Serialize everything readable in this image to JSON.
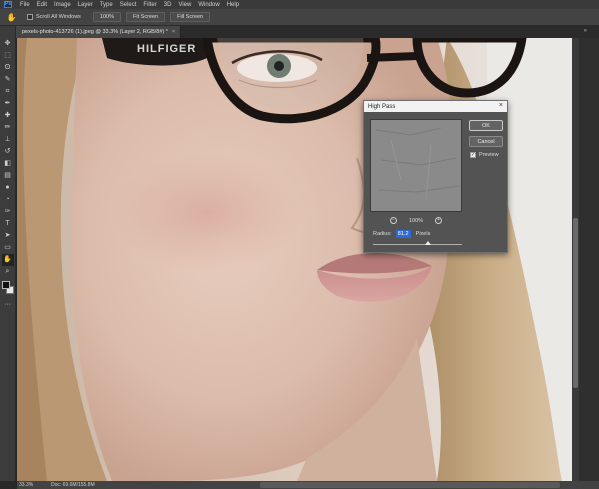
{
  "menubar": {
    "logo": "Ps",
    "items": [
      "File",
      "Edit",
      "Image",
      "Layer",
      "Type",
      "Select",
      "Filter",
      "3D",
      "View",
      "Window",
      "Help"
    ]
  },
  "options_bar": {
    "tool_icon": "hand-icon",
    "scroll_all_windows_label": "Scroll All Windows",
    "scroll_all_windows_checked": false,
    "zoom_btn": "100%",
    "fit_screen_btn": "Fit Screen",
    "fill_screen_btn": "Fill Screen"
  },
  "document_tab": {
    "title": "pexels-photo-413726 (1).jpeg @ 33.3% (Layer 2, RGB/8#) *",
    "close": "×"
  },
  "tools": [
    {
      "name": "move-tool",
      "icon": "✥"
    },
    {
      "name": "marquee-tool",
      "icon": "⬚"
    },
    {
      "name": "lasso-tool",
      "icon": "ʘ"
    },
    {
      "name": "quick-select-tool",
      "icon": "✎"
    },
    {
      "name": "crop-tool",
      "icon": "⌗"
    },
    {
      "name": "eyedropper-tool",
      "icon": "✒"
    },
    {
      "name": "healing-tool",
      "icon": "✚"
    },
    {
      "name": "brush-tool",
      "icon": "✏"
    },
    {
      "name": "clone-stamp-tool",
      "icon": "⊥"
    },
    {
      "name": "history-brush-tool",
      "icon": "↺"
    },
    {
      "name": "eraser-tool",
      "icon": "◧"
    },
    {
      "name": "gradient-tool",
      "icon": "▤"
    },
    {
      "name": "blur-tool",
      "icon": "●"
    },
    {
      "name": "dodge-tool",
      "icon": "◔"
    },
    {
      "name": "pen-tool",
      "icon": "✑"
    },
    {
      "name": "type-tool",
      "icon": "T"
    },
    {
      "name": "path-select-tool",
      "icon": "➤"
    },
    {
      "name": "shape-tool",
      "icon": "▭"
    },
    {
      "name": "hand-tool",
      "icon": "✋"
    },
    {
      "name": "zoom-tool",
      "icon": "⌕"
    },
    {
      "name": "more-tools",
      "icon": "···"
    }
  ],
  "status_bar": {
    "zoom": "33.3%",
    "doc": "Doc: 69.6M/155.8M"
  },
  "high_pass_dialog": {
    "title": "High Pass",
    "close": "×",
    "ok_label": "OK",
    "cancel_label": "Cancel",
    "preview_label": "Preview",
    "preview_checked": true,
    "zoom_value": "100%",
    "zoom_out_icon": "−",
    "zoom_in_icon": "+",
    "radius_label": "Radius:",
    "radius_value": "81.2",
    "radius_unit": "Pixels",
    "slider_fraction": 0.62
  }
}
